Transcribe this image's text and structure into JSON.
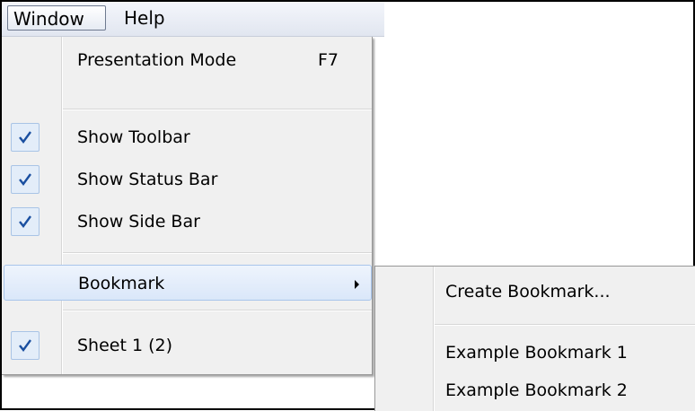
{
  "menubar": {
    "window_label": "Window",
    "help_label": "Help"
  },
  "window_menu": {
    "items": [
      {
        "label": "Presentation Mode",
        "shortcut": "F7",
        "checked": false
      },
      {
        "label": "Show Toolbar",
        "checked": true
      },
      {
        "label": "Show Status Bar",
        "checked": true
      },
      {
        "label": "Show Side Bar",
        "checked": true
      },
      {
        "label": "Bookmark",
        "has_submenu": true,
        "highlighted": true
      },
      {
        "label": "Sheet 1 (2)",
        "checked": true
      }
    ]
  },
  "bookmark_submenu": {
    "items": [
      {
        "label": "Create Bookmark..."
      },
      {
        "label": "Example Bookmark 1"
      },
      {
        "label": "Example Bookmark 2"
      }
    ]
  },
  "colors": {
    "check_color": "#1a4fa0",
    "highlight_border": "#a8c5eb",
    "menu_background": "#f0f0f0"
  }
}
